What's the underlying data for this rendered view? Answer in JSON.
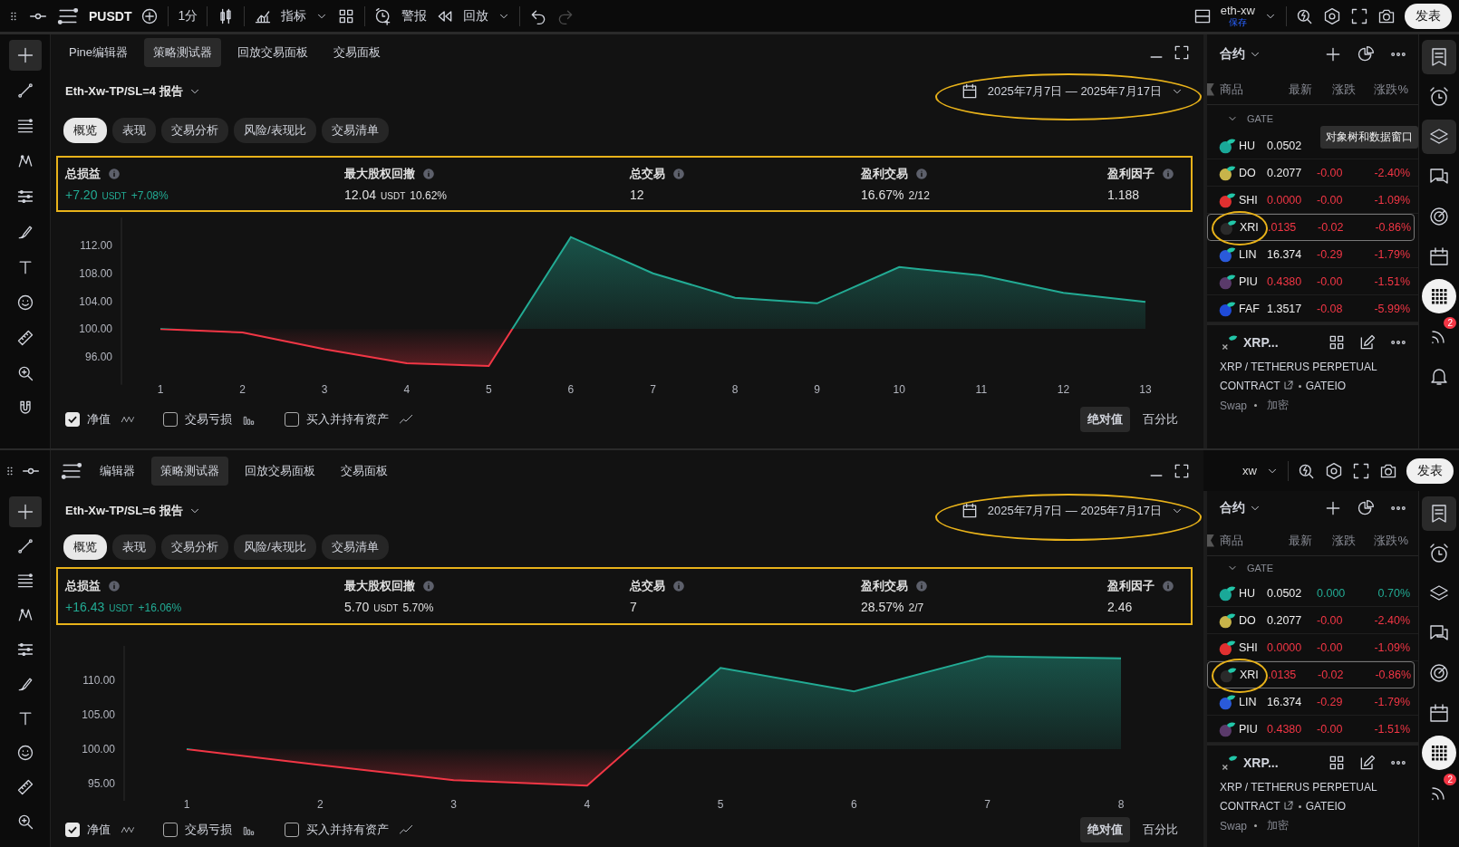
{
  "toolbar": {
    "symbol": "PUSDT",
    "interval": "1分",
    "indicators": "指标",
    "alerts": "警报",
    "replay": "回放",
    "layout_name": "eth-xw",
    "save_status": "保存",
    "publish": "发表",
    "redo_disabled": true
  },
  "panes": [
    {
      "tabs": [
        {
          "label": "Pine编辑器",
          "selected": false
        },
        {
          "label": "策略测试器",
          "selected": true
        },
        {
          "label": "回放交易面板",
          "selected": false
        },
        {
          "label": "交易面板",
          "selected": false
        }
      ],
      "report_title": "Eth-Xw-TP/SL=4 报告",
      "date_range": {
        "text": "2025年7月7日 — 2025年7月17日",
        "circled": true
      },
      "subtabs": [
        {
          "label": "概览",
          "selected": true
        },
        {
          "label": "表现",
          "selected": false
        },
        {
          "label": "交易分析",
          "selected": false
        },
        {
          "label": "风险/表现比",
          "selected": false
        },
        {
          "label": "交易清单",
          "selected": false
        }
      ],
      "stats": {
        "highlighted": true,
        "items": [
          {
            "label": "总损益",
            "value": "+7.20",
            "unit": "USDT",
            "extra": "+7.08%",
            "positive": true
          },
          {
            "label": "最大股权回撤",
            "value": "12.04",
            "unit": "USDT",
            "extra": "10.62%",
            "positive": false
          },
          {
            "label": "总交易",
            "value": "12",
            "positive": false
          },
          {
            "label": "盈利交易",
            "value": "16.67%",
            "extra": "2/12",
            "positive": false
          },
          {
            "label": "盈利因子",
            "value": "1.188",
            "positive": false
          }
        ]
      },
      "chart_data": {
        "type": "area",
        "x": [
          1,
          2,
          3,
          4,
          5,
          6,
          7,
          8,
          9,
          10,
          11,
          12,
          13
        ],
        "series": [
          {
            "color": "#22ab94",
            "values": [
              100.0,
              99.5,
              97.1,
              95.1,
              94.7,
              113.2,
              108.0,
              104.5,
              103.7,
              108.9,
              107.7,
              105.2,
              103.9
            ]
          }
        ],
        "xlim": [
          1,
          13
        ],
        "ylim": [
          92,
          116
        ],
        "yticks": [
          {
            "value": 96,
            "label": "96.00"
          },
          {
            "value": 100,
            "label": "100.00"
          },
          {
            "value": 104,
            "label": "104.00"
          },
          {
            "value": 108,
            "label": "108.00"
          },
          {
            "value": 112,
            "label": "112.00"
          }
        ],
        "xticks": [
          1,
          2,
          3,
          4,
          5,
          6,
          7,
          8,
          9,
          10,
          11,
          12,
          13
        ]
      },
      "legend": [
        {
          "label": "净值",
          "checked": true,
          "kind": "wave"
        },
        {
          "label": "交易亏损",
          "checked": false,
          "kind": "bars"
        },
        {
          "label": "买入并持有资产",
          "checked": false,
          "kind": "line"
        }
      ],
      "scale_buttons": [
        {
          "label": "绝对值",
          "selected": true
        },
        {
          "label": "百分比",
          "selected": false
        }
      ],
      "tools": [
        {
          "kind": "crosshair",
          "selected": true
        },
        {
          "kind": "trend",
          "selected": false
        },
        {
          "kind": "fib",
          "selected": false
        },
        {
          "kind": "pattern",
          "selected": false
        },
        {
          "kind": "measure",
          "selected": false
        },
        {
          "kind": "brush",
          "selected": false
        },
        {
          "kind": "text",
          "selected": false
        },
        {
          "kind": "emoji",
          "selected": false
        },
        {
          "kind": "ruler",
          "selected": false
        },
        {
          "kind": "zoom",
          "selected": false
        },
        {
          "kind": "magnet",
          "selected": false
        }
      ],
      "watchlist": {
        "title": "合约",
        "columns": [
          "商品",
          "最新",
          "涨跌",
          "涨跌%"
        ],
        "group": "GATE",
        "rows": [
          {
            "symbol": "HU",
            "last": "0.0502",
            "price_down": false,
            "color": "#1aa898",
            "selected": false,
            "circled": false
          },
          {
            "symbol": "DO",
            "last": "0.2077",
            "change": "-0.00",
            "change_pct": "-2.40%",
            "price_down": false,
            "change_down": true,
            "color": "#c8b44a",
            "selected": false,
            "circled": false
          },
          {
            "symbol": "SHI",
            "last": "0.0000",
            "change": "-0.00",
            "change_pct": "-1.09%",
            "price_down": true,
            "change_down": true,
            "color": "#e03030",
            "selected": false,
            "circled": false
          },
          {
            "symbol": "XRI",
            "last": ".0135",
            "change": "-0.02",
            "change_pct": "-0.86%",
            "price_down": true,
            "change_down": true,
            "color": "#2a2a2a",
            "selected": true,
            "circled": true
          },
          {
            "symbol": "LIN",
            "last": "16.374",
            "change": "-0.29",
            "change_pct": "-1.79%",
            "price_down": false,
            "change_down": true,
            "color": "#2a5ada",
            "selected": false,
            "circled": false
          },
          {
            "symbol": "PIU",
            "last": "0.4380",
            "change": "-0.00",
            "change_pct": "-1.51%",
            "price_down": true,
            "change_down": true,
            "color": "#5a3a6a",
            "selected": false,
            "circled": false
          },
          {
            "symbol": "FAF",
            "last": "1.3517",
            "change": "-0.08",
            "change_pct": "-5.99%",
            "price_down": false,
            "change_down": true,
            "color": "#1f4bd8",
            "selected": false,
            "circled": false
          }
        ]
      },
      "symbol": {
        "name": "XRP...",
        "description": "XRP / TETHERUS PERPETUAL CONTRACT",
        "exchange": "GATEIO",
        "type": "Swap",
        "category": "加密"
      },
      "side_icons": [
        {
          "kind": "watchlist",
          "selected": true
        },
        {
          "kind": "alarm",
          "selected": false
        },
        {
          "kind": "layers",
          "selected": true,
          "tooltip": "对象树和数据窗口"
        },
        {
          "kind": "chat",
          "selected": false
        },
        {
          "kind": "target",
          "selected": false
        },
        {
          "kind": "calendar",
          "selected": false
        },
        {
          "kind": "apps",
          "selected": true
        },
        {
          "kind": "signals",
          "selected": false,
          "badge": "2"
        },
        {
          "kind": "bell",
          "selected": false
        }
      ]
    },
    {
      "toolbar_fragment": {
        "layout_name": "xw",
        "publish": "发表"
      },
      "tabs": [
        {
          "label": "编辑器",
          "selected": false
        },
        {
          "label": "策略测试器",
          "selected": true
        },
        {
          "label": "回放交易面板",
          "selected": false
        },
        {
          "label": "交易面板",
          "selected": false
        }
      ],
      "report_title": "Eth-Xw-TP/SL=6 报告",
      "date_range": {
        "text": "2025年7月7日 — 2025年7月17日",
        "circled": true
      },
      "subtabs": [
        {
          "label": "概览",
          "selected": true
        },
        {
          "label": "表现",
          "selected": false
        },
        {
          "label": "交易分析",
          "selected": false
        },
        {
          "label": "风险/表现比",
          "selected": false
        },
        {
          "label": "交易清单",
          "selected": false
        }
      ],
      "stats": {
        "highlighted": true,
        "items": [
          {
            "label": "总损益",
            "value": "+16.43",
            "unit": "USDT",
            "extra": "+16.06%",
            "positive": true
          },
          {
            "label": "最大股权回撤",
            "value": "5.70",
            "unit": "USDT",
            "extra": "5.70%",
            "positive": false
          },
          {
            "label": "总交易",
            "value": "7",
            "positive": false
          },
          {
            "label": "盈利交易",
            "value": "28.57%",
            "extra": "2/7",
            "positive": false
          },
          {
            "label": "盈利因子",
            "value": "2.46",
            "positive": false
          }
        ]
      },
      "chart_data": {
        "type": "area",
        "x": [
          1,
          2,
          3,
          4,
          5,
          6,
          7,
          8
        ],
        "series": [
          {
            "color": "#22ab94",
            "values": [
              100.0,
              97.7,
              95.5,
              94.7,
              111.8,
              108.4,
              113.5,
              113.2
            ]
          }
        ],
        "xlim": [
          1,
          8
        ],
        "ylim": [
          92.5,
          115
        ],
        "yticks": [
          {
            "value": 95,
            "label": "95.00"
          },
          {
            "value": 100,
            "label": "100.00"
          },
          {
            "value": 105,
            "label": "105.00"
          },
          {
            "value": 110,
            "label": "110.00"
          }
        ],
        "xticks": [
          1,
          2,
          3,
          4,
          5,
          6,
          7,
          8
        ]
      },
      "legend": [
        {
          "label": "净值",
          "checked": true,
          "kind": "wave"
        },
        {
          "label": "交易亏损",
          "checked": false,
          "kind": "bars"
        },
        {
          "label": "买入并持有资产",
          "checked": false,
          "kind": "line"
        }
      ],
      "scale_buttons": [
        {
          "label": "绝对值",
          "selected": true
        },
        {
          "label": "百分比",
          "selected": false
        }
      ],
      "tools": [
        {
          "kind": "crosshair",
          "selected": true
        },
        {
          "kind": "trend",
          "selected": false
        },
        {
          "kind": "fib",
          "selected": false
        },
        {
          "kind": "pattern",
          "selected": false
        },
        {
          "kind": "measure",
          "selected": false
        },
        {
          "kind": "brush",
          "selected": false
        },
        {
          "kind": "text",
          "selected": false
        },
        {
          "kind": "emoji",
          "selected": false
        },
        {
          "kind": "ruler",
          "selected": false
        },
        {
          "kind": "zoom",
          "selected": false
        }
      ],
      "watchlist": {
        "title": "合约",
        "columns": [
          "商品",
          "最新",
          "涨跌",
          "涨跌%"
        ],
        "group": "GATE",
        "rows": [
          {
            "symbol": "HU",
            "last": "0.0502",
            "change": "0.000",
            "change_pct": "0.70%",
            "price_down": false,
            "change_down": false,
            "color": "#1aa898",
            "selected": false,
            "circled": false
          },
          {
            "symbol": "DO",
            "last": "0.2077",
            "change": "-0.00",
            "change_pct": "-2.40%",
            "price_down": false,
            "change_down": true,
            "color": "#c8b44a",
            "selected": false,
            "circled": false
          },
          {
            "symbol": "SHI",
            "last": "0.0000",
            "change": "-0.00",
            "change_pct": "-1.09%",
            "price_down": true,
            "change_down": true,
            "color": "#e03030",
            "selected": false,
            "circled": false
          },
          {
            "symbol": "XRI",
            "last": ".0135",
            "change": "-0.02",
            "change_pct": "-0.86%",
            "price_down": true,
            "change_down": true,
            "color": "#2a2a2a",
            "selected": true,
            "circled": true
          },
          {
            "symbol": "LIN",
            "last": "16.374",
            "change": "-0.29",
            "change_pct": "-1.79%",
            "price_down": false,
            "change_down": true,
            "color": "#2a5ada",
            "selected": false,
            "circled": false
          },
          {
            "symbol": "PIU",
            "last": "0.4380",
            "change": "-0.00",
            "change_pct": "-1.51%",
            "price_down": true,
            "change_down": true,
            "color": "#5a3a6a",
            "selected": false,
            "circled": false
          }
        ]
      },
      "symbol": {
        "name": "XRP...",
        "description": "XRP / TETHERUS PERPETUAL CONTRACT",
        "exchange": "GATEIO",
        "type": "Swap",
        "category": "加密"
      },
      "side_icons": [
        {
          "kind": "watchlist",
          "selected": true
        },
        {
          "kind": "alarm",
          "selected": false
        },
        {
          "kind": "layers",
          "selected": false
        },
        {
          "kind": "chat",
          "selected": false
        },
        {
          "kind": "target",
          "selected": false
        },
        {
          "kind": "calendar",
          "selected": false
        },
        {
          "kind": "apps",
          "selected": true
        },
        {
          "kind": "signals",
          "selected": false,
          "badge": "2"
        }
      ]
    }
  ]
}
